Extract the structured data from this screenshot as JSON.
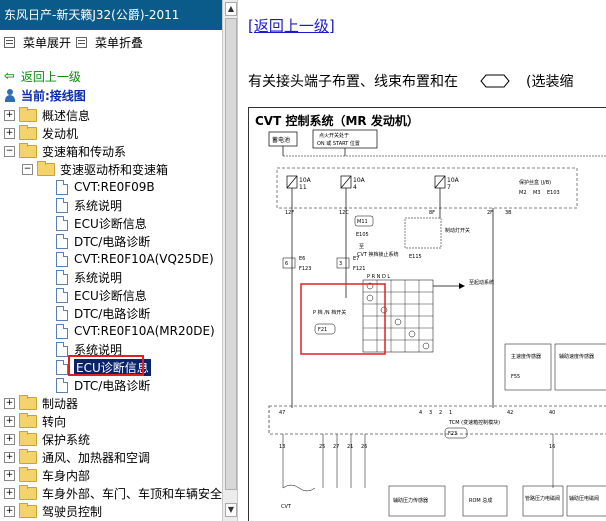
{
  "window": {
    "title": "东风日产-新天籁J32(公爵)-2011"
  },
  "menu": {
    "expand": "菜单展开",
    "collapse": "菜单折叠"
  },
  "nav": {
    "back": "返回上一级",
    "current": "当前:接线图"
  },
  "tree": {
    "n0": "概述信息",
    "n1": "发动机",
    "n2": "变速箱和传动系",
    "n3": "变速驱动桥和变速箱",
    "n4": "CVT:RE0F09B",
    "n5": "系统说明",
    "n6": "ECU诊断信息",
    "n7": "DTC/电路诊断",
    "n8": "CVT:RE0F10A(VQ25DE)",
    "n9": "系统说明",
    "n10": "ECU诊断信息",
    "n11": "DTC/电路诊断",
    "n12": "CVT:RE0F10A(MR20DE)",
    "n13": "系统说明",
    "n14": "ECU诊断信息",
    "n15": "DTC/电路诊断",
    "n16": "制动器",
    "n17": "转向",
    "n18": "保护系统",
    "n19": "通风、加热器和空调",
    "n20": "车身内部",
    "n21": "车身外部、车门、车顶和车辆安全",
    "n22": "驾驶员控制"
  },
  "content": {
    "return_link": "[返回上一级]",
    "desc_text": "有关接头端子布置、线束布置和在",
    "desc_tail": "(选装缩",
    "diagram_title": "CVT 控制系统（MR 发动机）"
  },
  "diagram": {
    "battery": "蓄电池",
    "ign": "点火开关处于",
    "ign2": "ON 或 START 位置",
    "jb": "保护丝盒 (J/B)",
    "fuse1": "10A",
    "fuse1n": "11",
    "fuse2": "10A",
    "fuse2n": "4",
    "fuse3": "10A",
    "fuse3n": "7",
    "c12f": "12F",
    "c12c": "12C",
    "c8f": "8F",
    "c2f": "2F",
    "c3b": "3B",
    "m2": "M2",
    "m3": "M3",
    "e103": "E103",
    "m11": "M11",
    "e105": "E105",
    "e6": "E6",
    "f123": "F123",
    "e7": "E7",
    "f121": "F121",
    "e115": "E115",
    "cvt_sw": "CVT 换档锁止系统",
    "to": "至",
    "brake_sw": "制动灯开关",
    "to_start": "至起动系统",
    "prndl": "P R N D L",
    "pn_sw": "P 档 /N 档开关",
    "f21": "F21",
    "main_sensor": "主速度传感器",
    "f55": "F55",
    "aux_sensor": "辅助速度传感器",
    "tcm": "TCM (变速箱控制模块)",
    "f23": "F23",
    "p47": "47",
    "p4": "4",
    "p3": "3",
    "p2": "2",
    "p1": "1",
    "p42": "42",
    "p40": "40",
    "p13": "13",
    "p25": "25",
    "p27": "27",
    "p21": "21",
    "p26": "26",
    "p16": "16",
    "cvt_label": "CVT",
    "aux_press": "辅助压力传感器",
    "rom": "ROM 总成",
    "tube_press": "管路压力电磁阀",
    "aux_press2": "辅助压电磁阀"
  },
  "colors": {
    "title_bar": "#0a5a8a",
    "selection": "#0a246a",
    "highlight": "#e02020",
    "link": "#1a1acc",
    "back": "#0b8a0b"
  }
}
